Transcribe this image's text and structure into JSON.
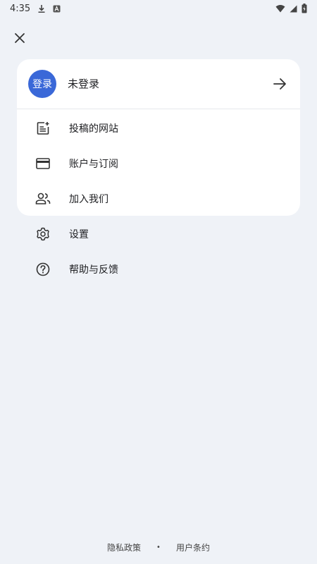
{
  "status_bar": {
    "time": "4:35"
  },
  "header": {
    "close_icon": "close-icon"
  },
  "account": {
    "avatar_text": "登录",
    "status_label": "未登录",
    "accent_color": "#3a68d8"
  },
  "menu": {
    "items": [
      {
        "label": "投稿的网站",
        "icon": "document-add-icon"
      },
      {
        "label": "账户与订阅",
        "icon": "credit-card-icon"
      },
      {
        "label": "加入我们",
        "icon": "people-icon"
      }
    ],
    "secondary": [
      {
        "label": "设置",
        "icon": "gear-icon"
      },
      {
        "label": "帮助与反馈",
        "icon": "help-icon"
      }
    ]
  },
  "footer": {
    "privacy": "隐私政策",
    "separator": "•",
    "terms": "用户条约"
  }
}
